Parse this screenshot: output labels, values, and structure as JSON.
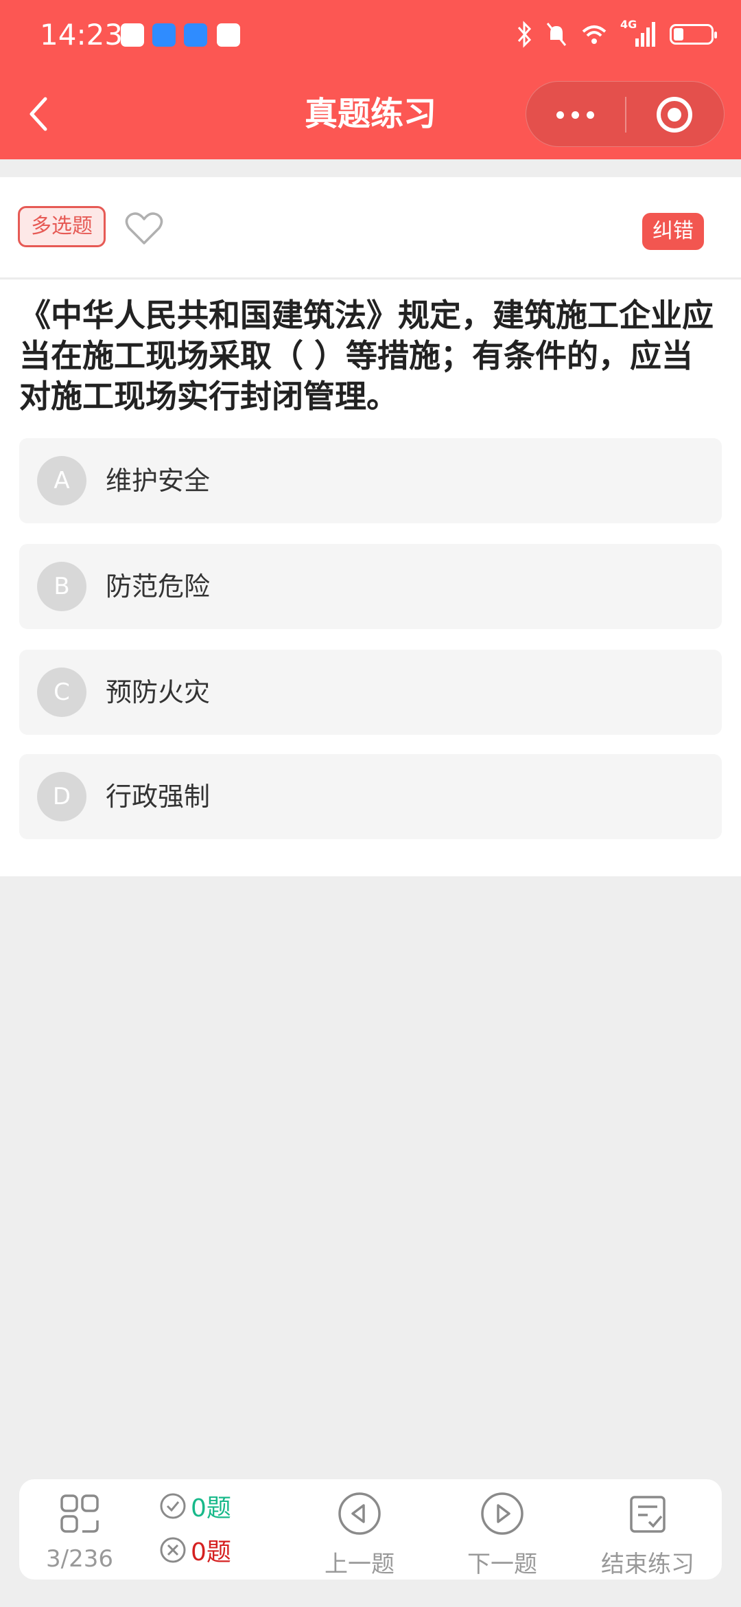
{
  "status_bar": {
    "time": "14:23",
    "network_label": "4G"
  },
  "header": {
    "title": "真题练习"
  },
  "question": {
    "type_tag": "多选题",
    "report_label": "纠错",
    "text": "《中华人民共和国建筑法》规定，建筑施工企业应当在施工现场采取（ ）等措施；有条件的，应当对施工现场实行封闭管理。",
    "options": [
      {
        "letter": "A",
        "text": "维护安全"
      },
      {
        "letter": "B",
        "text": "防范危险"
      },
      {
        "letter": "C",
        "text": "预防火灾"
      },
      {
        "letter": "D",
        "text": "行政强制"
      }
    ]
  },
  "bottom_bar": {
    "progress": "3/236",
    "correct_count": "0题",
    "wrong_count": "0题",
    "prev_label": "上一题",
    "next_label": "下一题",
    "end_label": "结束练习"
  },
  "colors": {
    "header_bg": "#fc5753",
    "accent": "#f25650",
    "correct": "#18b98a",
    "wrong": "#d52020"
  },
  "icons": [
    "back-arrow-icon",
    "more-dots-icon",
    "target-close-icon",
    "heart-icon",
    "grid-icon",
    "check-circle-icon",
    "x-circle-icon",
    "prev-triangle-icon",
    "next-triangle-icon",
    "finish-list-icon"
  ]
}
